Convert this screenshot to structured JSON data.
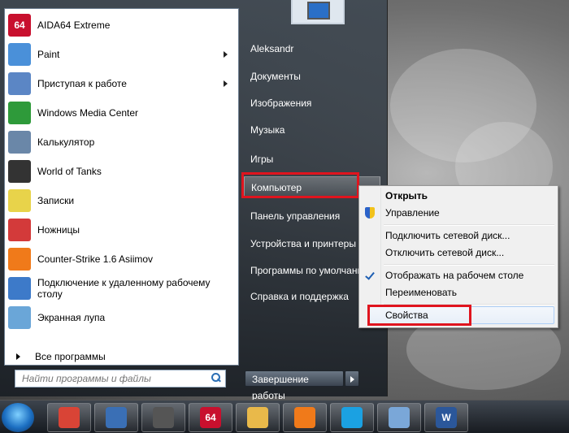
{
  "start_menu": {
    "programs": [
      {
        "label": "AIDA64 Extreme",
        "icon": "aida64-icon",
        "icon_text": "64",
        "color": "#c8102e",
        "has_arrow": false
      },
      {
        "label": "Paint",
        "icon": "paint-icon",
        "icon_text": "",
        "color": "#4a90d9",
        "has_arrow": true
      },
      {
        "label": "Приступая к работе",
        "icon": "getting-started-icon",
        "icon_text": "",
        "color": "#5b86c5",
        "has_arrow": true
      },
      {
        "label": "Windows Media Center",
        "icon": "media-center-icon",
        "icon_text": "",
        "color": "#2e9a3a",
        "has_arrow": false
      },
      {
        "label": "Калькулятор",
        "icon": "calculator-icon",
        "icon_text": "",
        "color": "#6a87a8",
        "has_arrow": false
      },
      {
        "label": "World of Tanks",
        "icon": "world-of-tanks-icon",
        "icon_text": "",
        "color": "#333333",
        "has_arrow": false
      },
      {
        "label": "Записки",
        "icon": "sticky-notes-icon",
        "icon_text": "",
        "color": "#e8d34a",
        "has_arrow": false
      },
      {
        "label": "Ножницы",
        "icon": "snipping-tool-icon",
        "icon_text": "",
        "color": "#d33a3a",
        "has_arrow": false
      },
      {
        "label": "Counter-Strike 1.6 Asiimov",
        "icon": "counter-strike-icon",
        "icon_text": "",
        "color": "#f07a1a",
        "has_arrow": false
      },
      {
        "label": "Подключение к удаленному рабочему столу",
        "icon": "remote-desktop-icon",
        "icon_text": "",
        "color": "#3d7ac9",
        "has_arrow": false
      },
      {
        "label": "Экранная лупа",
        "icon": "magnifier-icon",
        "icon_text": "",
        "color": "#6aa6d8",
        "has_arrow": false
      }
    ],
    "all_programs": "Все программы",
    "search_placeholder": "Найти программы и файлы",
    "right_items": [
      {
        "label": "Aleksandr"
      },
      {
        "label": "Документы"
      },
      {
        "label": "Изображения"
      },
      {
        "label": "Музыка"
      },
      {
        "label": "Игры"
      },
      {
        "label": "Компьютер"
      },
      {
        "label": "Панель управления"
      },
      {
        "label": "Устройства и принтеры"
      },
      {
        "label": "Программы по умолчанию"
      },
      {
        "label": "Справка и поддержка"
      }
    ],
    "shutdown": "Завершение работы"
  },
  "context_menu": {
    "open": "Открыть",
    "manage": "Управление",
    "map_drive": "Подключить сетевой диск...",
    "disconnect_drive": "Отключить сетевой диск...",
    "show_on_desktop": "Отображать на рабочем столе",
    "rename": "Переименовать",
    "properties": "Свойства"
  },
  "taskbar": {
    "apps": [
      "chrome-icon",
      "save-disk-icon",
      "alien-icon",
      "aida64-icon",
      "file-explorer-icon",
      "media-player-icon",
      "skype-icon",
      "paint-icon",
      "word-icon"
    ],
    "aida_text": "64",
    "word_text": "W"
  },
  "colors": {
    "highlight": "#e0141e",
    "accent": "#1e5fb3"
  }
}
